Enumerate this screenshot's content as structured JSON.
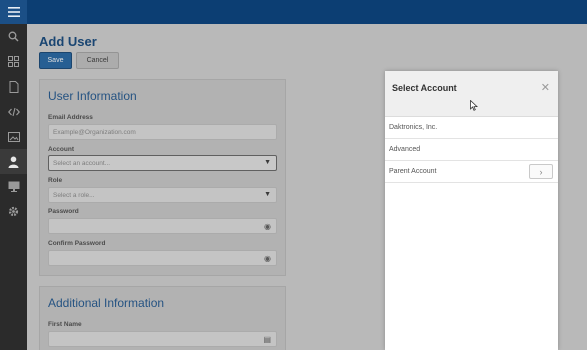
{
  "sidebar": {
    "menu_icon": "hamburger-icon",
    "items": [
      {
        "icon": "search-icon"
      },
      {
        "icon": "grid-icon"
      },
      {
        "icon": "document-icon"
      },
      {
        "icon": "code-icon"
      },
      {
        "icon": "image-icon"
      },
      {
        "icon": "user-icon",
        "active": true
      },
      {
        "icon": "monitor-icon"
      },
      {
        "icon": "gear-icon"
      }
    ]
  },
  "page": {
    "title": "Add User",
    "save_label": "Save",
    "cancel_label": "Cancel"
  },
  "user_info": {
    "title": "User Information",
    "email_label": "Email Address",
    "email_placeholder": "Example@Organization.com",
    "account_label": "Account",
    "account_value": "Select an account...",
    "role_label": "Role",
    "role_value": "Select a role...",
    "password_label": "Password",
    "confirm_label": "Confirm Password"
  },
  "additional_info": {
    "title": "Additional Information",
    "first_name_label": "First Name"
  },
  "modal": {
    "title": "Select Account",
    "close_glyph": "✕",
    "accounts": [
      "Daktronics, Inc.",
      "Advanced",
      "Parent Account"
    ],
    "row_arrow_glyph": "›"
  },
  "colors": {
    "topbar": "#0c3e73",
    "accent": "#2d6da8",
    "panel_title": "#2b5f95"
  }
}
